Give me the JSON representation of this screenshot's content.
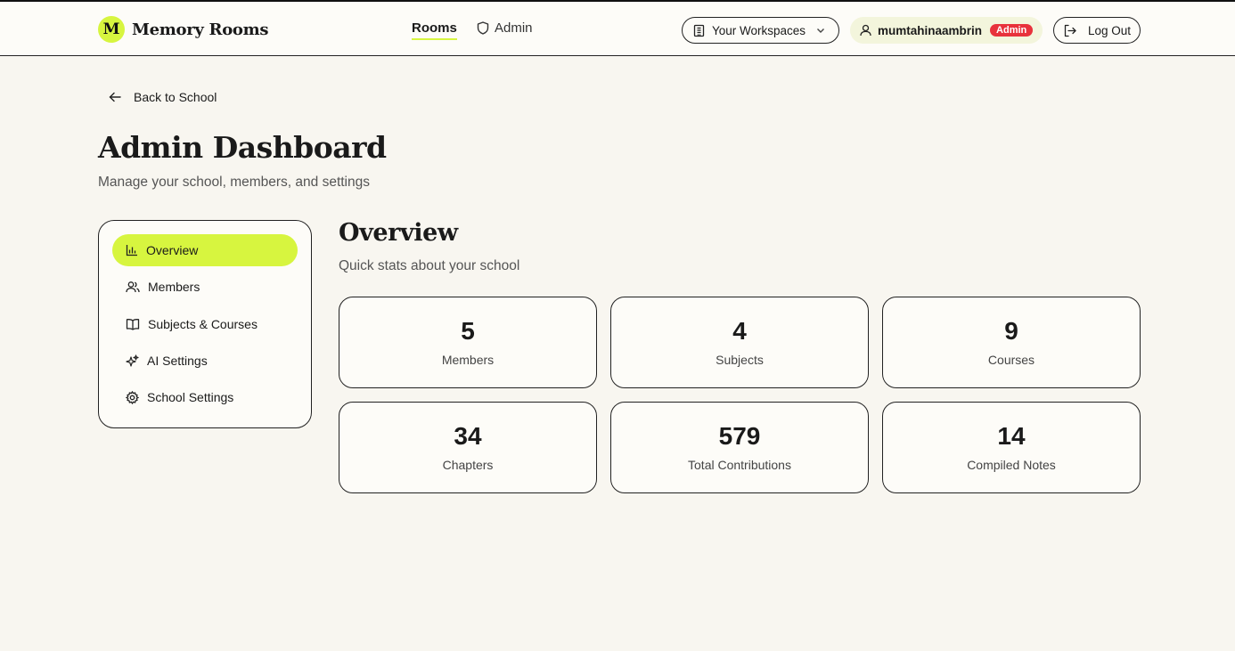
{
  "header": {
    "logo_letter": "M",
    "app_name": "Memory Rooms",
    "nav": {
      "rooms": "Rooms",
      "admin": "Admin"
    },
    "workspaces_label": "Your Workspaces",
    "username": "mumtahinaambrin",
    "role_badge": "Admin",
    "logout_label": "Log Out",
    "accent_color": "#d7f53f",
    "badge_color": "#e8323c"
  },
  "back_link": "Back to School",
  "page": {
    "title": "Admin Dashboard",
    "subtitle": "Manage your school, members, and settings"
  },
  "sidebar": {
    "items": [
      {
        "label": "Overview",
        "icon": "bar-chart-icon",
        "active": true
      },
      {
        "label": "Members",
        "icon": "users-icon",
        "active": false
      },
      {
        "label": "Subjects & Courses",
        "icon": "book-icon",
        "active": false
      },
      {
        "label": "AI Settings",
        "icon": "sparkles-icon",
        "active": false
      },
      {
        "label": "School Settings",
        "icon": "gear-icon",
        "active": false
      }
    ]
  },
  "overview": {
    "title": "Overview",
    "subtitle": "Quick stats about your school",
    "stats": [
      {
        "value": "5",
        "label": "Members"
      },
      {
        "value": "4",
        "label": "Subjects"
      },
      {
        "value": "9",
        "label": "Courses"
      },
      {
        "value": "34",
        "label": "Chapters"
      },
      {
        "value": "579",
        "label": "Total Contributions"
      },
      {
        "value": "14",
        "label": "Compiled Notes"
      }
    ]
  }
}
